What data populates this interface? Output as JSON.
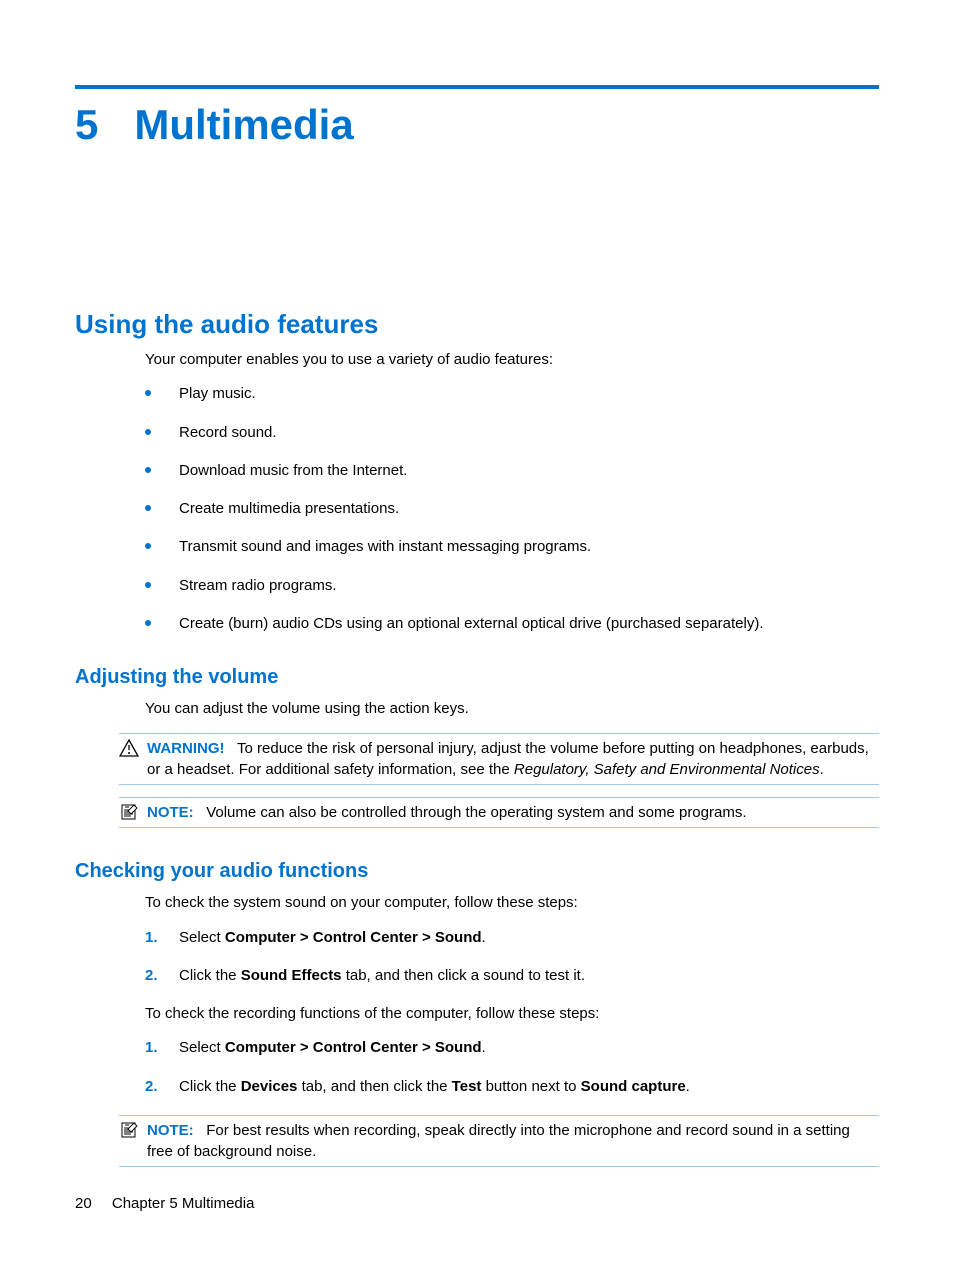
{
  "chapter": {
    "number": "5",
    "title": "Multimedia"
  },
  "h2": "Using the audio features",
  "intro": "Your computer enables you to use a variety of audio features:",
  "bullets": [
    "Play music.",
    "Record sound.",
    "Download music from the Internet.",
    "Create multimedia presentations.",
    "Transmit sound and images with instant messaging programs.",
    "Stream radio programs.",
    "Create (burn) audio CDs using an optional external optical drive (purchased separately)."
  ],
  "adjusting": {
    "heading": "Adjusting the volume",
    "text": "You can adjust the volume using the action keys.",
    "warning_label": "WARNING!",
    "warning_text_before": "To reduce the risk of personal injury, adjust the volume before putting on headphones, earbuds, or a headset. For additional safety information, see the ",
    "warning_italic": "Regulatory, Safety and Environmental Notices",
    "warning_text_after": ".",
    "note_label": "NOTE:",
    "note_text": "Volume can also be controlled through the operating system and some programs."
  },
  "checking": {
    "heading": "Checking your audio functions",
    "intro": "To check the system sound on your computer, follow these steps:",
    "steps1": {
      "s1_pre": "Select ",
      "s1_bold": "Computer > Control Center > Sound",
      "s1_post": ".",
      "s2_pre": "Click the ",
      "s2_bold": "Sound Effects",
      "s2_post": " tab, and then click a sound to test it."
    },
    "mid": "To check the recording functions of the computer, follow these steps:",
    "steps2": {
      "s1_pre": "Select ",
      "s1_bold": "Computer > Control Center > Sound",
      "s1_post": ".",
      "s2_pre": "Click the ",
      "s2_b1": "Devices",
      "s2_mid1": " tab, and then click the ",
      "s2_b2": "Test",
      "s2_mid2": " button next to ",
      "s2_b3": "Sound capture",
      "s2_post": "."
    },
    "note_label": "NOTE:",
    "note_text": "For best results when recording, speak directly into the microphone and record sound in a setting free of background noise."
  },
  "footer": {
    "page": "20",
    "chapter_label": "Chapter 5   Multimedia"
  }
}
